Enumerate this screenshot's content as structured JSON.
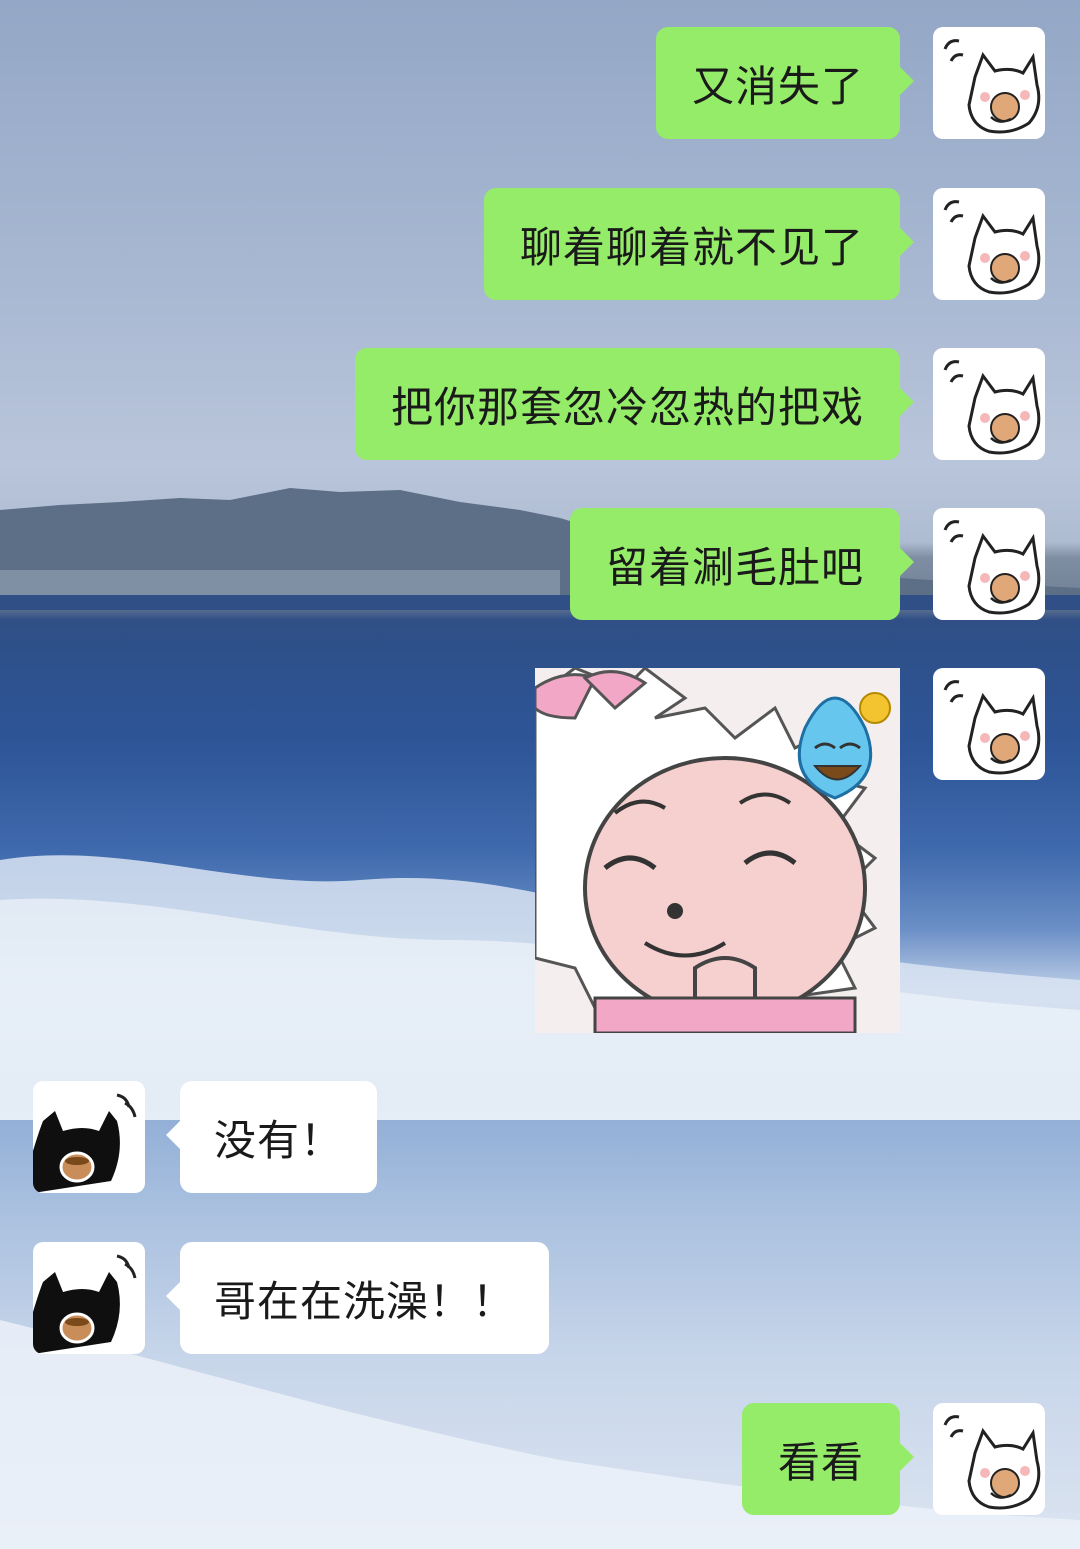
{
  "chat": {
    "messages": [
      {
        "side": "me",
        "text": "又消失了"
      },
      {
        "side": "me",
        "text": "聊着聊着就不见了"
      },
      {
        "side": "me",
        "text": "把你那套忽冷忽热的把戏"
      },
      {
        "side": "me",
        "text": "留着涮毛肚吧"
      },
      {
        "side": "me",
        "type": "sticker",
        "sticker": "pink-sheep-sweat-smile-sticker"
      },
      {
        "side": "other",
        "text": "没有！"
      },
      {
        "side": "other",
        "text": "哥在在洗澡！！"
      },
      {
        "side": "me",
        "text": "看看"
      }
    ]
  },
  "colors": {
    "my_bubble": "#95ec69",
    "other_bubble": "#ffffff"
  },
  "avatars": {
    "me": "white-cat-eating-cookie-avatar",
    "other": "black-cat-drinking-coffee-avatar"
  },
  "background": "ocean-beach-wallpaper"
}
